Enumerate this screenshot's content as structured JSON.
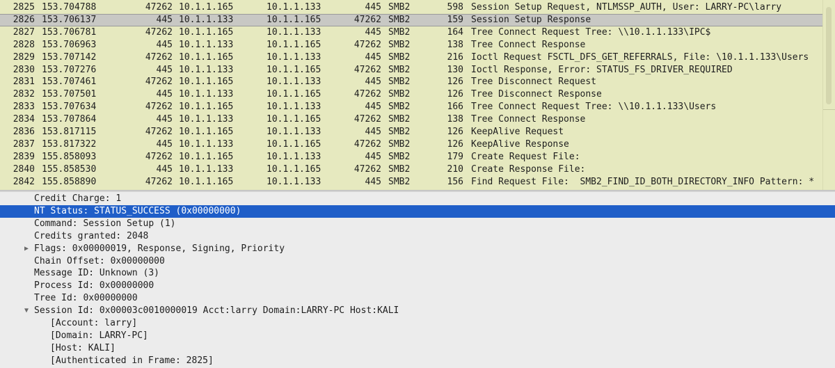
{
  "packet_list": {
    "rows": [
      {
        "no": "2825",
        "time": "153.704788",
        "src_port": "47262",
        "source": "10.1.1.165",
        "destination": "10.1.1.133",
        "dst_port": "445",
        "protocol": "SMB2",
        "length": "598",
        "info": "Session Setup Request, NTLMSSP_AUTH, User: LARRY-PC\\larry"
      },
      {
        "no": "2826",
        "time": "153.706137",
        "src_port": "445",
        "source": "10.1.1.133",
        "destination": "10.1.1.165",
        "dst_port": "47262",
        "protocol": "SMB2",
        "length": "159",
        "info": "Session Setup Response",
        "selected": true
      },
      {
        "no": "2827",
        "time": "153.706781",
        "src_port": "47262",
        "source": "10.1.1.165",
        "destination": "10.1.1.133",
        "dst_port": "445",
        "protocol": "SMB2",
        "length": "164",
        "info": "Tree Connect Request Tree: \\\\10.1.1.133\\IPC$"
      },
      {
        "no": "2828",
        "time": "153.706963",
        "src_port": "445",
        "source": "10.1.1.133",
        "destination": "10.1.1.165",
        "dst_port": "47262",
        "protocol": "SMB2",
        "length": "138",
        "info": "Tree Connect Response"
      },
      {
        "no": "2829",
        "time": "153.707142",
        "src_port": "47262",
        "source": "10.1.1.165",
        "destination": "10.1.1.133",
        "dst_port": "445",
        "protocol": "SMB2",
        "length": "216",
        "info": "Ioctl Request FSCTL_DFS_GET_REFERRALS, File: \\10.1.1.133\\Users"
      },
      {
        "no": "2830",
        "time": "153.707276",
        "src_port": "445",
        "source": "10.1.1.133",
        "destination": "10.1.1.165",
        "dst_port": "47262",
        "protocol": "SMB2",
        "length": "130",
        "info": "Ioctl Response, Error: STATUS_FS_DRIVER_REQUIRED"
      },
      {
        "no": "2831",
        "time": "153.707461",
        "src_port": "47262",
        "source": "10.1.1.165",
        "destination": "10.1.1.133",
        "dst_port": "445",
        "protocol": "SMB2",
        "length": "126",
        "info": "Tree Disconnect Request"
      },
      {
        "no": "2832",
        "time": "153.707501",
        "src_port": "445",
        "source": "10.1.1.133",
        "destination": "10.1.1.165",
        "dst_port": "47262",
        "protocol": "SMB2",
        "length": "126",
        "info": "Tree Disconnect Response"
      },
      {
        "no": "2833",
        "time": "153.707634",
        "src_port": "47262",
        "source": "10.1.1.165",
        "destination": "10.1.1.133",
        "dst_port": "445",
        "protocol": "SMB2",
        "length": "166",
        "info": "Tree Connect Request Tree: \\\\10.1.1.133\\Users"
      },
      {
        "no": "2834",
        "time": "153.707864",
        "src_port": "445",
        "source": "10.1.1.133",
        "destination": "10.1.1.165",
        "dst_port": "47262",
        "protocol": "SMB2",
        "length": "138",
        "info": "Tree Connect Response"
      },
      {
        "no": "2836",
        "time": "153.817115",
        "src_port": "47262",
        "source": "10.1.1.165",
        "destination": "10.1.1.133",
        "dst_port": "445",
        "protocol": "SMB2",
        "length": "126",
        "info": "KeepAlive Request"
      },
      {
        "no": "2837",
        "time": "153.817322",
        "src_port": "445",
        "source": "10.1.1.133",
        "destination": "10.1.1.165",
        "dst_port": "47262",
        "protocol": "SMB2",
        "length": "126",
        "info": "KeepAlive Response"
      },
      {
        "no": "2839",
        "time": "155.858093",
        "src_port": "47262",
        "source": "10.1.1.165",
        "destination": "10.1.1.133",
        "dst_port": "445",
        "protocol": "SMB2",
        "length": "179",
        "info": "Create Request File:"
      },
      {
        "no": "2840",
        "time": "155.858530",
        "src_port": "445",
        "source": "10.1.1.133",
        "destination": "10.1.1.165",
        "dst_port": "47262",
        "protocol": "SMB2",
        "length": "210",
        "info": "Create Response File:"
      },
      {
        "no": "2842",
        "time": "155.858890",
        "src_port": "47262",
        "source": "10.1.1.165",
        "destination": "10.1.1.133",
        "dst_port": "445",
        "protocol": "SMB2",
        "length": "156",
        "info": "Find Request File:  SMB2_FIND_ID_BOTH_DIRECTORY_INFO Pattern: *"
      }
    ]
  },
  "packet_details": {
    "rows": [
      {
        "text": "Credit Charge: 1",
        "level": 1
      },
      {
        "text": "NT Status: STATUS_SUCCESS (0x00000000)",
        "level": 1,
        "selected": true
      },
      {
        "text": "Command: Session Setup (1)",
        "level": 1
      },
      {
        "text": "Credits granted: 2048",
        "level": 1
      },
      {
        "text": "Flags: 0x00000019, Response, Signing, Priority",
        "level": 1,
        "expander": "collapsed"
      },
      {
        "text": "Chain Offset: 0x00000000",
        "level": 1
      },
      {
        "text": "Message ID: Unknown (3)",
        "level": 1
      },
      {
        "text": "Process Id: 0x00000000",
        "level": 1
      },
      {
        "text": "Tree Id: 0x00000000",
        "level": 1
      },
      {
        "text": "Session Id: 0x00003c0010000019 Acct:larry Domain:LARRY-PC Host:KALI",
        "level": 1,
        "expander": "expanded"
      },
      {
        "text": "[Account: larry]",
        "level": 2
      },
      {
        "text": "[Domain: LARRY-PC]",
        "level": 2
      },
      {
        "text": "[Host: KALI]",
        "level": 2
      },
      {
        "text": "[Authenticated in Frame: 2825]",
        "level": 2
      }
    ]
  },
  "icons": {
    "collapsed": "▶",
    "expanded": "▼"
  },
  "colors": {
    "packet_list_bg": "#e6e9bf",
    "selected_detail_bg": "#1f5ec8",
    "selected_packet_bg": "#c8c8c4",
    "details_bg": "#ececec"
  }
}
